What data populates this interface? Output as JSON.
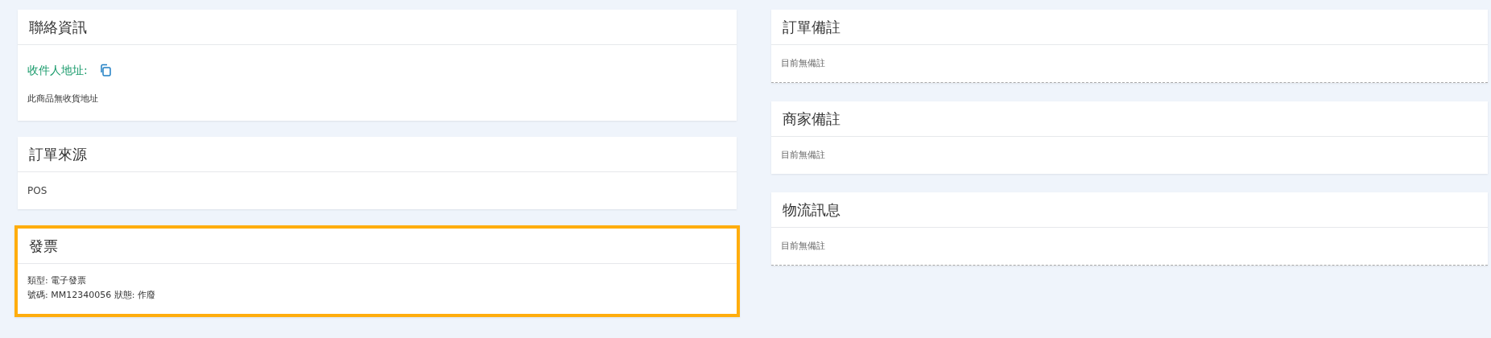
{
  "left_cards": [
    {
      "title": "聯絡資訊",
      "kind": "address",
      "label": "收件人地址:",
      "text": "此商品無收貨地址",
      "highlighted": false
    },
    {
      "title": "訂單來源",
      "kind": "text",
      "text": "POS",
      "highlighted": false
    },
    {
      "title": "發票",
      "kind": "lines",
      "lines": [
        "類型: 電子發票",
        "號碼: MM12340056 狀態: 作廢"
      ],
      "highlighted": true
    }
  ],
  "right_cards": [
    {
      "title": "訂單備註",
      "kind": "text",
      "text": "目前無備註",
      "dashed_bottom": true
    },
    {
      "title": "商家備註",
      "kind": "text",
      "text": "目前無備註",
      "dashed_bottom": false
    },
    {
      "title": "物流訊息",
      "kind": "text",
      "text": "目前無備註",
      "dashed_bottom": true
    }
  ]
}
